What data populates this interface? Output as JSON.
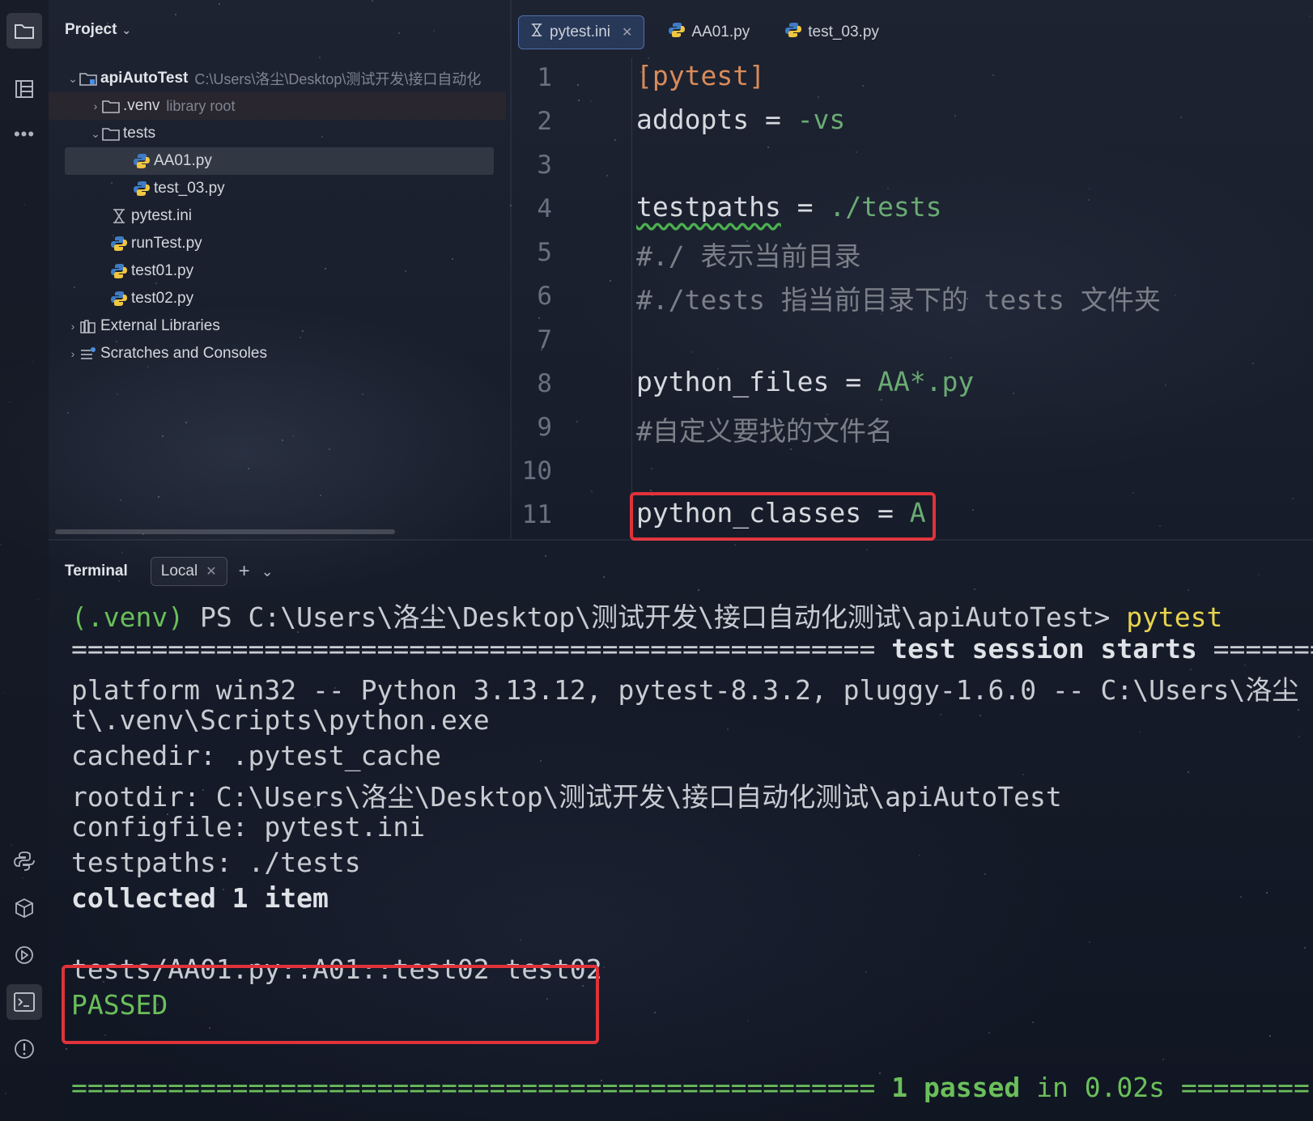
{
  "project": {
    "header_label": "Project",
    "items": [
      {
        "name": "apiAutoTest",
        "hint": "C:\\Users\\洛尘\\Desktop\\测试开发\\接口自动化"
      },
      {
        "name": ".venv",
        "hint": "library root"
      },
      {
        "name": "tests"
      },
      {
        "name": "AA01.py"
      },
      {
        "name": "test_03.py"
      },
      {
        "name": "pytest.ini"
      },
      {
        "name": "runTest.py"
      },
      {
        "name": "test01.py"
      },
      {
        "name": "test02.py"
      },
      {
        "name": "External Libraries"
      },
      {
        "name": "Scratches and Consoles"
      }
    ]
  },
  "editor": {
    "tabs": [
      {
        "label": "pytest.ini",
        "active": true
      },
      {
        "label": "AA01.py"
      },
      {
        "label": "test_03.py"
      }
    ],
    "line_numbers": [
      "1",
      "2",
      "3",
      "4",
      "5",
      "6",
      "7",
      "8",
      "9",
      "10",
      "11"
    ],
    "lines": {
      "l1": "[pytest]",
      "l2_key": "addopts = ",
      "l2_val": "-vs",
      "l4_key": "testpaths",
      "l4_eq": " = ",
      "l4_val": "./tests",
      "l5": "#./ 表示当前目录",
      "l6": "#./tests 指当前目录下的 tests 文件夹",
      "l8_key": "python_files = ",
      "l8_val": "AA*.py",
      "l9": "#自定义要找的文件名",
      "l11_key": "python_classes = ",
      "l11_val": "A"
    }
  },
  "terminal": {
    "title": "Terminal",
    "tab_label": "Local",
    "prompt_venv": "(.venv)",
    "prompt_path": " PS C:\\Users\\洛尘\\Desktop\\测试开发\\接口自动化测试\\apiAutoTest> ",
    "prompt_cmd": "pytest",
    "session_rule": "================================================== ",
    "session_title": "test session starts",
    "session_rule_end": " =======",
    "platform_line": "platform win32 -- Python 3.13.12, pytest-8.3.2, pluggy-1.6.0 -- C:\\Users\\洛尘",
    "exe_line": "t\\.venv\\Scripts\\python.exe",
    "cachedir_line": "cachedir: .pytest_cache",
    "rootdir_line": "rootdir: C:\\Users\\洛尘\\Desktop\\测试开发\\接口自动化测试\\apiAutoTest",
    "configfile_line": "configfile: pytest.ini",
    "testpaths_line": "testpaths: ./tests",
    "collected_line": "collected 1 item",
    "result_line": "tests/AA01.py::A01::test02 test02",
    "passed_label": "PASSED",
    "summary_rule": "================================================== ",
    "summary_count": "1 passed",
    "summary_time": " in 0.02s ",
    "summary_rule_end": "========"
  },
  "colors": {
    "highlight_box": "#e0323a",
    "string_green": "#6aab73",
    "section_orange": "#d98b5a",
    "prompt_yellow": "#e8d44d"
  }
}
